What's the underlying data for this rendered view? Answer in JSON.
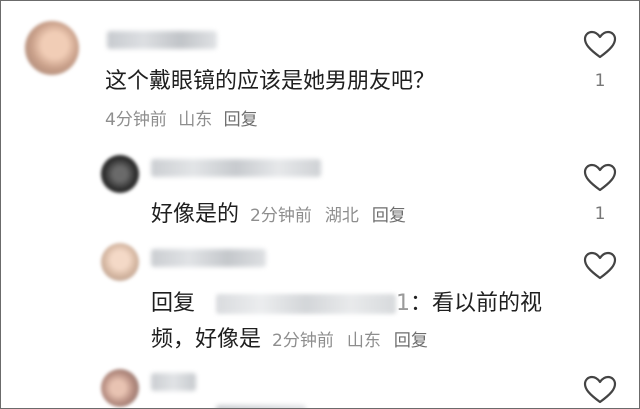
{
  "comments": [
    {
      "text": "这个戴眼镜的应该是她男朋友吧？",
      "time": "4分钟前",
      "location": "山东",
      "reply_label": "回复",
      "likes": "1"
    },
    {
      "text": "好像是的",
      "time": "2分钟前",
      "location": "湖北",
      "reply_label": "回复",
      "likes": "1"
    },
    {
      "reply_prefix": "回复",
      "handle_tail": "1",
      "text_after_handle": "：看以前的视",
      "text_line2": "频，好像是",
      "time": "2分钟前",
      "location": "山东",
      "reply_label": "回复"
    }
  ],
  "icons": {
    "like": "heart-outline-icon"
  },
  "colors": {
    "text": "#1f1f1f",
    "meta": "#8e8e8e",
    "icon": "#444444"
  }
}
